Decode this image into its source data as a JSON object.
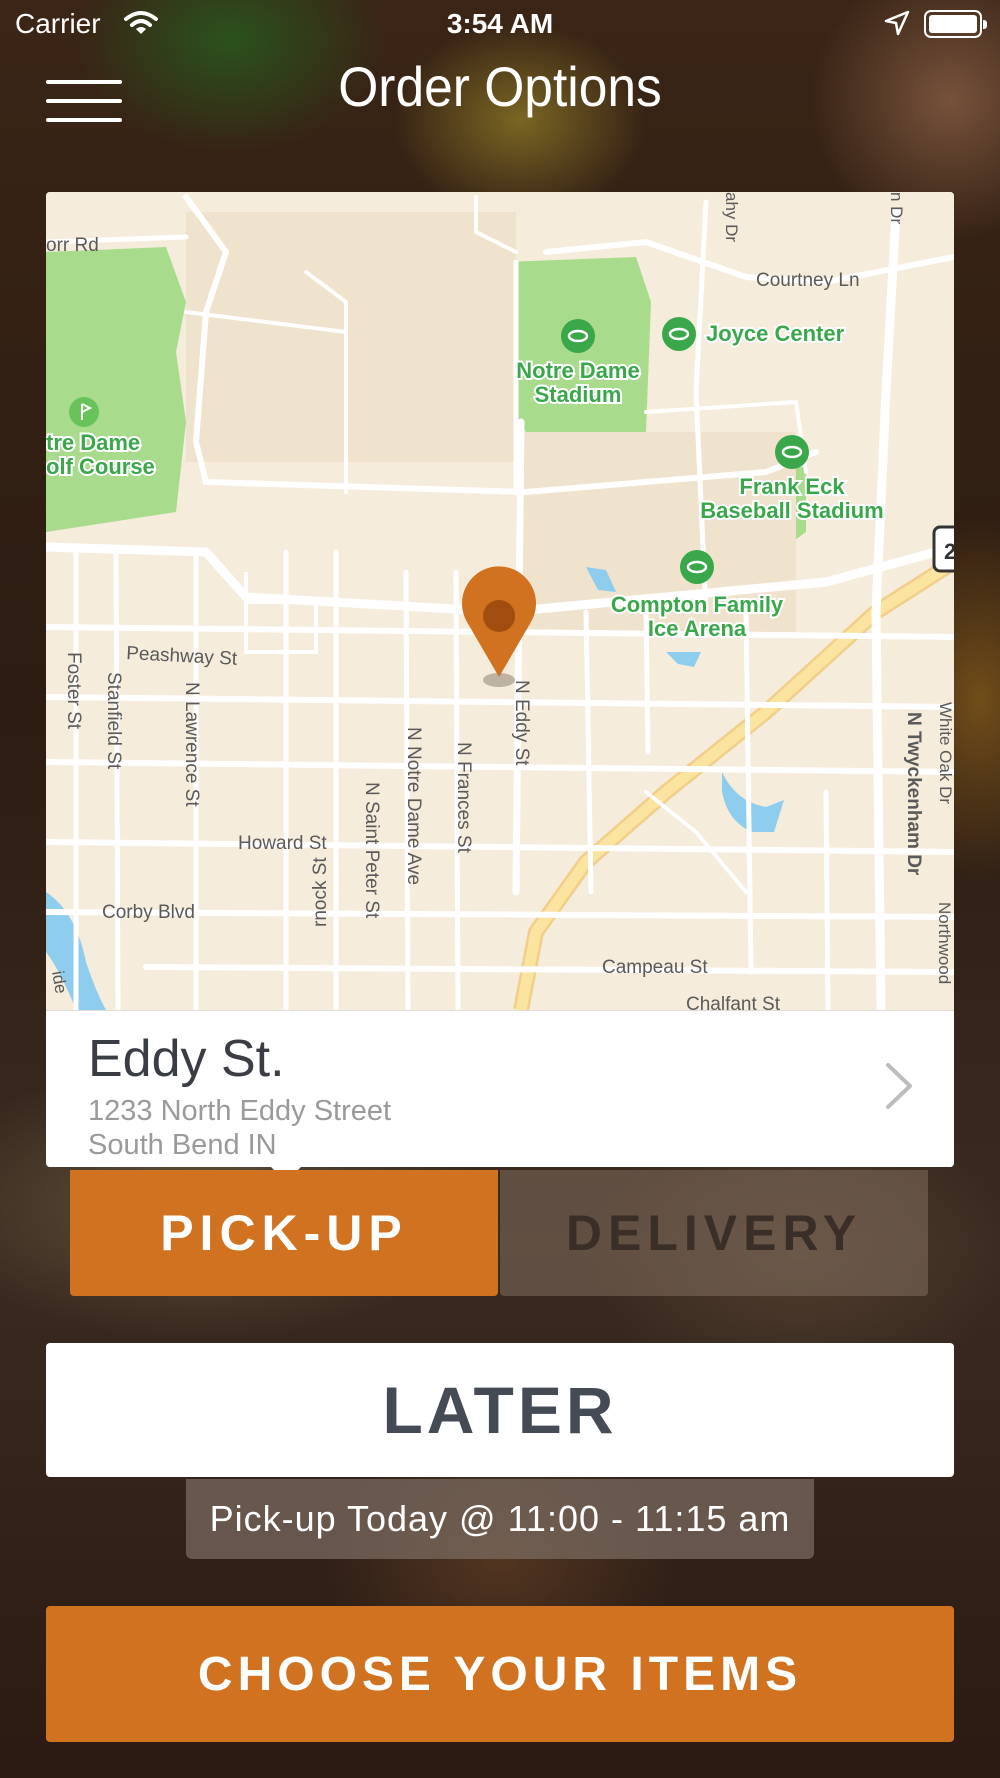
{
  "status_bar": {
    "carrier": "Carrier",
    "time": "3:54 AM"
  },
  "header": {
    "title": "Order Options",
    "menu_icon": "hamburger-menu-icon"
  },
  "map": {
    "streets": [
      "orr Rd",
      "Courtney Ln",
      "Peashway St",
      "Foster St",
      "Stanfield St",
      "N Lawrence St",
      "N Notre Dame Ave",
      "N Saint Peter St",
      "N Frances St",
      "N Eddy St",
      "Howard St",
      "Corby Blvd",
      "rnock St",
      "Campeau St",
      "Chalfant St",
      "N Twyckenham Dr",
      "White Oak Dr",
      "Northwood",
      "ahy Dr",
      "n Dr",
      "ide"
    ],
    "places": {
      "notre_dame_stadium_1": "Notre Dame",
      "notre_dame_stadium_2": "Stadium",
      "joyce_center": "Joyce Center",
      "golf_1": "tre Dame",
      "golf_2": "olf Course",
      "frank_eck_1": "Frank Eck",
      "frank_eck_2": "Baseball Stadium",
      "compton_1": "Compton Family",
      "compton_2": "Ice Arena"
    },
    "route_sign": "2"
  },
  "location": {
    "name": "Eddy St.",
    "address_line1": "1233 North Eddy Street",
    "address_line2": "South Bend IN"
  },
  "tabs": {
    "pickup": "PICK-UP",
    "delivery": "DELIVERY",
    "selected": "pickup"
  },
  "timing": {
    "label": "LATER",
    "pickup_time": "Pick-up Today @ 11:00 - 11:15 am"
  },
  "cta": {
    "label": "CHOOSE YOUR ITEMS"
  },
  "colors": {
    "accent": "#d07220",
    "map_bg": "#f5ecdc",
    "park": "#a8dc8c",
    "poi": "#3aa84a",
    "highway": "#fbe3a0",
    "water": "#8fcdee"
  }
}
